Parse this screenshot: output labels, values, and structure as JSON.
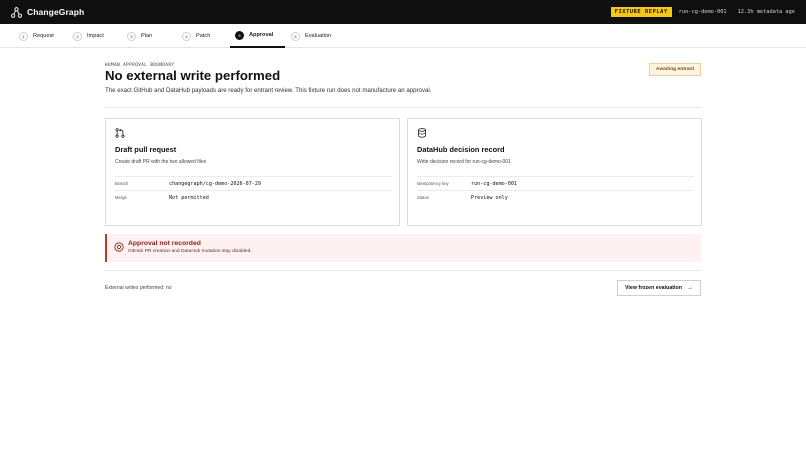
{
  "app": {
    "name": "ChangeGraph",
    "fixture_badge": "FIXTURE REPLAY",
    "run_id": "run-cg-demo-001",
    "metadata_age": "12.3h metadata age"
  },
  "steps": [
    {
      "num": "1",
      "label": "Request"
    },
    {
      "num": "2",
      "label": "Impact"
    },
    {
      "num": "3",
      "label": "Plan"
    },
    {
      "num": "4",
      "label": "Patch"
    },
    {
      "num": "5",
      "label": "Approval",
      "active": true
    },
    {
      "num": "6",
      "label": "Evaluation"
    }
  ],
  "hero": {
    "eyebrow": "HUMAN APPROVAL BOUNDARY",
    "title": "No external write performed",
    "description": "The exact GitHub and DataHub payloads are ready for entrant review. This fixture run does not manufacture an approval.",
    "status": "Awaiting entrant"
  },
  "cards": {
    "github": {
      "icon": "git-pull-request-icon",
      "title": "Draft pull request",
      "description": "Create draft PR with the two allowed files",
      "rows": [
        {
          "key": "Branch",
          "value": "changegraph/cg-demo-2026-07-29"
        },
        {
          "key": "Merge",
          "value": "Not permitted"
        }
      ]
    },
    "datahub": {
      "icon": "database-icon",
      "title": "DataHub decision record",
      "description": "Write decision record for run-cg-demo-001",
      "rows": [
        {
          "key": "Idempotency key",
          "value": "run-cg-demo-001"
        },
        {
          "key": "Status",
          "value": "Preview only"
        }
      ]
    }
  },
  "alert": {
    "icon": "stop-circle-icon",
    "title": "Approval not recorded",
    "description": "GitHub PR creation and DataHub mutation stay disabled."
  },
  "footer": {
    "status_text": "External writes performed: no",
    "button_label": "View frozen evaluation"
  },
  "colors": {
    "topbar": "#0f0f0f",
    "badge": "#f5c518",
    "alert_border": "#c0392b",
    "pill_bg": "#fdf3e0"
  }
}
